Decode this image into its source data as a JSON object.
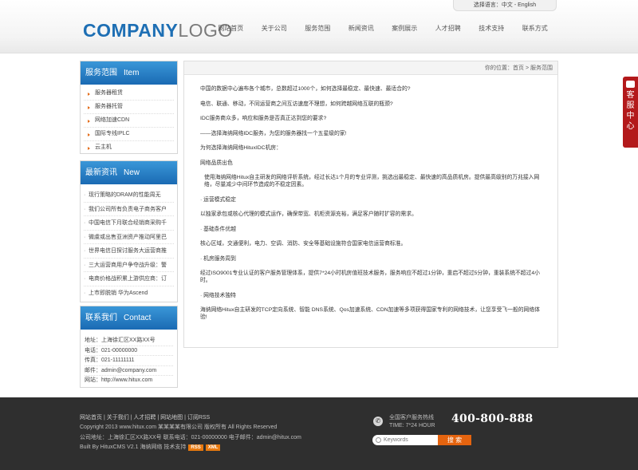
{
  "header": {
    "language_label": "选择语言：中文 - English",
    "logo_primary": "COMPANY",
    "logo_secondary": "LOGO",
    "nav": [
      "网站首页",
      "关于公司",
      "服务范围",
      "新闻资讯",
      "案例展示",
      "人才招聘",
      "技术支持",
      "联系方式"
    ]
  },
  "sidebar": {
    "services": {
      "title": "服务范围",
      "title_en": "Item",
      "items": [
        "服务器租赁",
        "服务器托管",
        "网络加速CDN",
        "国际专线IPLC",
        "云主机"
      ]
    },
    "news": {
      "title": "最新资讯",
      "title_en": "New",
      "items": [
        "现行策略的DRAM的性能周无",
        "我们公司所有负责电子商务客户",
        "中国电信下月联合经销商采购千",
        "微虞或出售亚洲资产推动阿里巴",
        "世界电信日探讨服务大运营商推",
        "三大运营商用户争夺战升级：警",
        "电商价格战积累上游供应商：订",
        "上市即脱销 华为Ascend"
      ]
    },
    "contact": {
      "title": "联系我们",
      "title_en": "Contact",
      "rows": [
        "地址：上海徐汇区XX路XX号",
        "电话：021-00000000",
        "传真：021-11111111",
        "邮件：admin@company.com",
        "网站：http://www.hitux.com"
      ]
    }
  },
  "main": {
    "breadcrumb": "你的位置：首页 > 服务范围",
    "paragraphs": [
      "中国的数据中心遍布各个城市，总数超过1000个，如何选择最稳定、最快速、最适合的?",
      "电信、联通、移动，不同运营商之间互访速度不理想，如何跨越网络互联的瓶颈?",
      "IDC服务商众多，响应和服务是否真正达到您的要求?",
      "——选择海纳网络IDC服务，为您的服务器找一个五星级的家!",
      "为何选择海纳网络HituxIDC机房：",
      "网络品质出色",
      "使用海纳网络Hitux自主研发的网络评析系统，经过长达1个月的专业评测，挑选出最稳定、最快速的高品质机房。提供最高级别的万兆接入网络，尽量减少中间环节造成的不稳定因素。",
      "· 运营模式稳定",
      "以独家承包或核心代理的模式运作，确保带宽、机柜资源充裕，满足客户随时扩容的需求。",
      "· 基础条件优越",
      "核心区域，交通便利，电力、空调、消防、安全等基础设施符合国家电信运营商标准。",
      "· 机房服务周到",
      "经过ISO9001专业认证的客户服务管理体系，提供7*24小时机房值班技术服务，服务响应不超过1分钟，重启不超过5分钟，重装系统不超过4小时。",
      "· 网络技术独特",
      "海纳网络Hitux自主研发的TCP定向系统、智能 DNS系统、Qos加速系统、CDN加速等多项获得国家专利的网络技术，让您享受飞一般的网络体验!"
    ]
  },
  "service_tab": {
    "chars": [
      "客",
      "服",
      "中",
      "心"
    ]
  },
  "footer": {
    "links": "网站首页 | 关于我们 | 人才招聘 | 网站地图 | 订阅RSS",
    "copyright": "Copyright 2013 www.hitux.com 某某某某有限公司 版权所有 All Rights Reserved",
    "address": "公司地址：上海徐汇区XX路XX号 联系电话：021-00000000 电子邮件：admin@hitux.com",
    "built_by": "Built By HituxCMS V2.1 海纳网络 技术支持",
    "rss_tag": "RSS",
    "xml_tag": "XML",
    "hotline_label_1": "全国客户服务热线",
    "hotline_label_2": "TIME: 7*24 HOUR",
    "hotline_number": "400-800-888",
    "search_placeholder": "Keywords",
    "search_button": "搜 索"
  }
}
